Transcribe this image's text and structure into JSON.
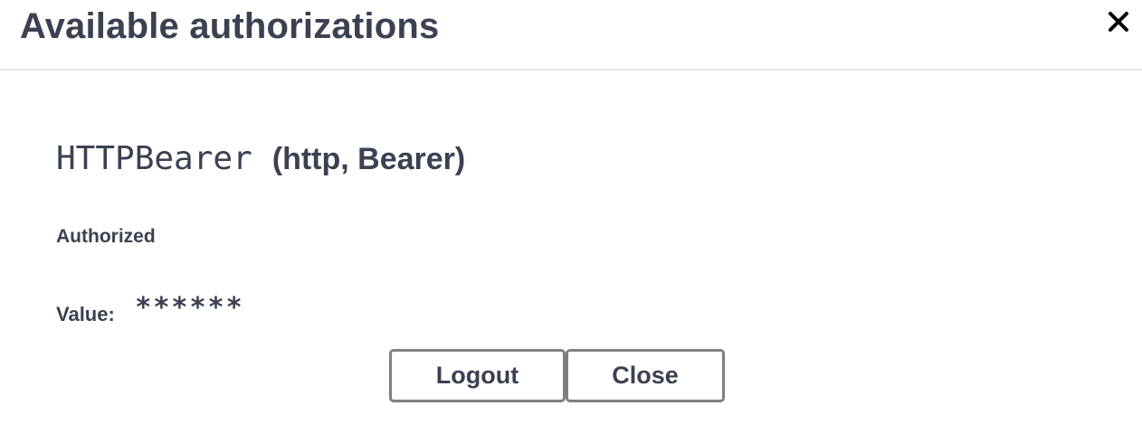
{
  "modal": {
    "title": "Available authorizations",
    "close_icon": "close-icon"
  },
  "scheme": {
    "name": "HTTPBearer",
    "type": "(http, Bearer)",
    "status": "Authorized",
    "value_label": "Value:",
    "value": "******"
  },
  "actions": {
    "logout_label": "Logout",
    "close_label": "Close"
  },
  "colors": {
    "text": "#3b4151",
    "border": "#808080",
    "divider": "#e6e6e6"
  }
}
